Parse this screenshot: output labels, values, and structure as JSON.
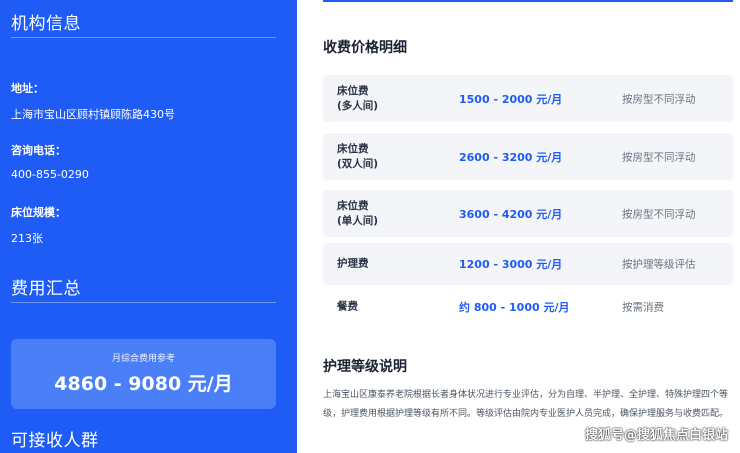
{
  "institution": {
    "title": "机构信息",
    "address_label": "地址：",
    "address_value": "上海市宝山区顾村镇顾陈路430号",
    "phone_label": "咨询电话：",
    "phone_value": "400-855-0290",
    "beds_label": "床位规模：",
    "beds_value": "213张"
  },
  "summary": {
    "title": "费用汇总",
    "caption": "月综合费用参考",
    "amount": "4860 - 9080 元/月"
  },
  "audience": {
    "title": "可接收人群"
  },
  "fees": {
    "title": "收费价格明细",
    "rows": [
      {
        "name1": "床位费",
        "name2": "(多人间)",
        "price": "1500 - 2000 元/月",
        "note": "按房型不同浮动"
      },
      {
        "name1": "床位费",
        "name2": "(双人间)",
        "price": "2600 - 3200 元/月",
        "note": "按房型不同浮动"
      },
      {
        "name1": "床位费",
        "name2": "(单人间)",
        "price": "3600 - 4200 元/月",
        "note": "按房型不同浮动"
      },
      {
        "name1": "护理费",
        "name2": "",
        "price": "1200 - 3000 元/月",
        "note": "按护理等级评估"
      },
      {
        "name1": "餐费",
        "name2": "",
        "price": "约 800 - 1000 元/月",
        "note": "按需消费"
      }
    ]
  },
  "care": {
    "title": "护理等级说明",
    "description": "上海宝山区康泰养老院根据长者身体状况进行专业评估，分为自理、半护理、全护理、特殊护理四个等级，护理费用根据护理等级有所不同。等级评估由院内专业医护人员完成，确保护理服务与收费匹配。"
  },
  "watermark": "搜狐号@搜狐焦点白银站",
  "colors": {
    "brand_blue": "#1f5cf5",
    "card_blue": "#4b7ff8",
    "row_bg": "#f3f5f8"
  }
}
